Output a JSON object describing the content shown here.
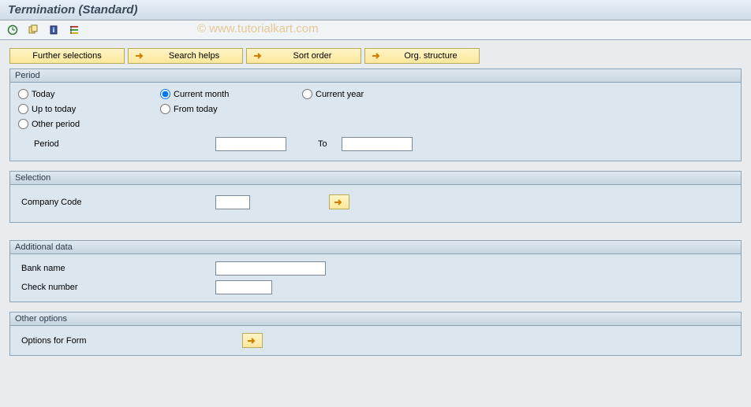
{
  "title": "Termination (Standard)",
  "watermark": "© www.tutorialkart.com",
  "actions": {
    "further": "Further selections",
    "search": "Search helps",
    "sort": "Sort order",
    "org": "Org. structure"
  },
  "period": {
    "legend": "Period",
    "today": "Today",
    "current_month": "Current month",
    "current_year": "Current year",
    "up_to_today": "Up to today",
    "from_today": "From today",
    "other_period": "Other period",
    "period_label": "Period",
    "to_label": "To",
    "selected": "current_month",
    "from_value": "",
    "to_value": ""
  },
  "selection": {
    "legend": "Selection",
    "company_code_label": "Company Code",
    "company_code_value": ""
  },
  "additional": {
    "legend": "Additional data",
    "bank_name_label": "Bank name",
    "bank_name_value": "",
    "check_number_label": "Check number",
    "check_number_value": ""
  },
  "other": {
    "legend": "Other options",
    "options_form_label": "Options for Form"
  }
}
